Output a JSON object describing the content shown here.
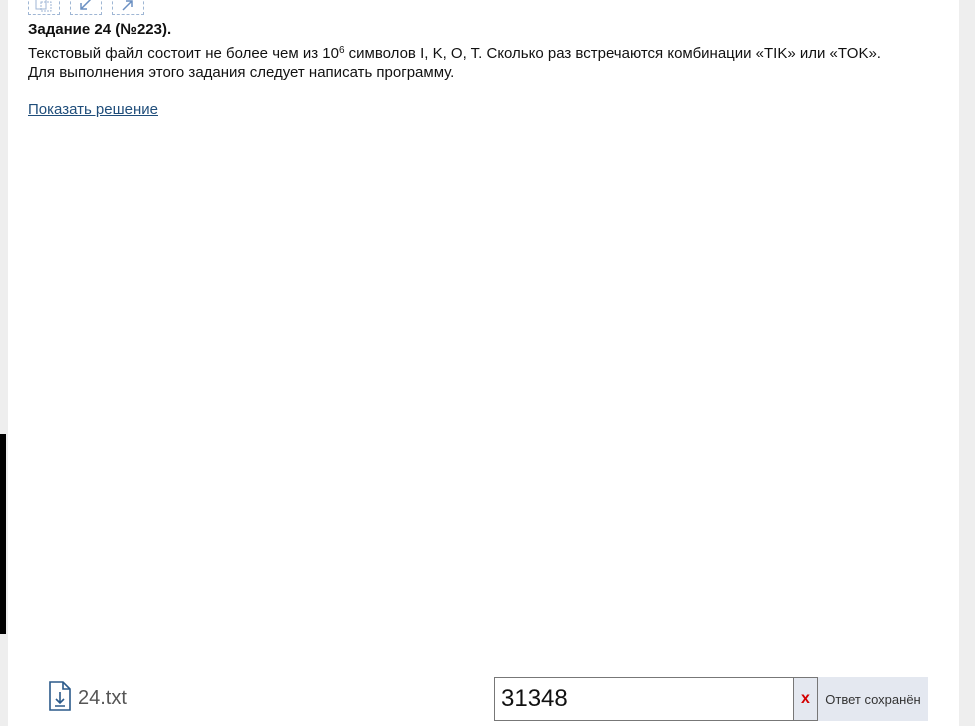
{
  "task": {
    "title": "Задание 24 (№223).",
    "text_before_power": "Текстовый файл состоит не более чем из 10",
    "power": "6",
    "text_after_power": " символов I, K, O, T. Сколько раз встречаются комбинации «TIK» или «TOK».",
    "text_line2": "Для выполнения этого задания следует написать программу.",
    "show_solution_label": "Показать решение"
  },
  "attachment": {
    "file_name": "24.txt",
    "icon": "download-file-icon"
  },
  "answer": {
    "value": "31348",
    "clear_label": "x",
    "status": "Ответ сохранён"
  },
  "toolbar_icons": [
    "copy-icon",
    "collapse-arrow-icon",
    "expand-arrow-icon"
  ],
  "colors": {
    "link": "#1f4d7a",
    "clear_x": "#d40000",
    "status_bg": "#e4e8f0"
  }
}
